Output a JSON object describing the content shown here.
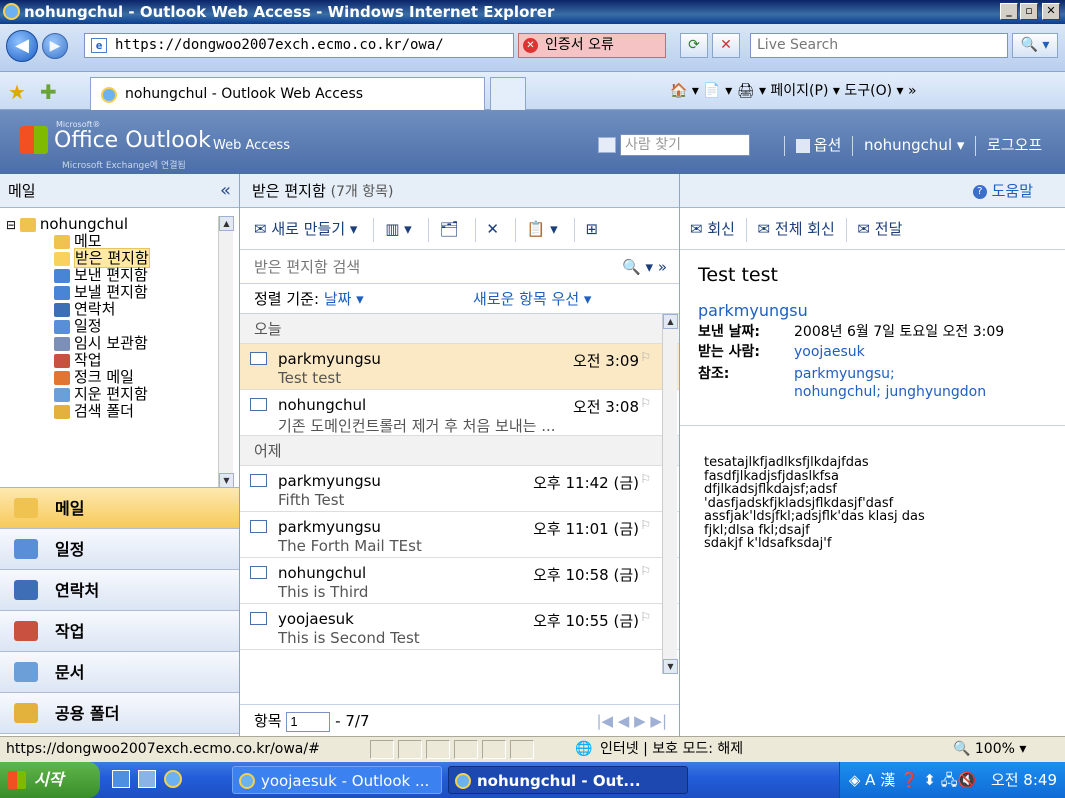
{
  "window": {
    "title": "nohungchul - Outlook Web Access - Windows Internet Explorer",
    "minimize": "_",
    "maximize": "▫",
    "close": "✕"
  },
  "browser": {
    "address": "https://dongwoo2007exch.ecmo.co.kr/owa/",
    "cert_error": "인증서 오류",
    "search_placeholder": "Live Search",
    "tab_title": "nohungchul - Outlook Web Access",
    "tools": "🏠 ▾  📄 ▾  🖨 ▾  페이지(P) ▾  도구(O) ▾  »"
  },
  "owa": {
    "logo_ms": "Microsoft®",
    "logo_title": "Office Outlook",
    "logo_title2": "Web Access",
    "logo_sub": "Microsoft Exchange에 연결됨",
    "find_people": "사람 찾기",
    "options": "옵션",
    "user": "nohungchul ▾",
    "logoff": "로그오프"
  },
  "left": {
    "header": "메일",
    "collapse": "«",
    "tree": [
      {
        "label": "nohungchul",
        "indent": 0
      },
      {
        "label": "메모",
        "indent": 1
      },
      {
        "label": "받은 편지함",
        "indent": 1,
        "selected": true
      },
      {
        "label": "보낸 편지함",
        "indent": 1
      },
      {
        "label": "보낼 편지함",
        "indent": 1
      },
      {
        "label": "연락처",
        "indent": 1
      },
      {
        "label": "일정",
        "indent": 1
      },
      {
        "label": "임시 보관함",
        "indent": 1
      },
      {
        "label": "작업",
        "indent": 1
      },
      {
        "label": "정크 메일",
        "indent": 1
      },
      {
        "label": "지운 편지함",
        "indent": 1
      },
      {
        "label": "검색 폴더",
        "indent": 1
      }
    ],
    "nav": [
      {
        "label": "메일",
        "active": true,
        "color": "#f0c350"
      },
      {
        "label": "일정",
        "active": false,
        "color": "#5b8ed8"
      },
      {
        "label": "연락처",
        "active": false,
        "color": "#3e6eb6"
      },
      {
        "label": "작업",
        "active": false,
        "color": "#c8513f"
      },
      {
        "label": "문서",
        "active": false,
        "color": "#6c9fd8"
      },
      {
        "label": "공용 폴더",
        "active": false,
        "color": "#e3b23c"
      }
    ]
  },
  "middle": {
    "header_title": "받은 편지함",
    "header_count": "(7개 항목)",
    "toolbar": {
      "new": "새로 만들기 ▾",
      "view": "▥ ▾",
      "move": "🗂",
      "delete": "✕",
      "copy": "📋 ▾",
      "more": "⊞"
    },
    "search_placeholder": "받은 편지함 검색",
    "search_btn": "🔍 ▾  »",
    "sort_label": "정렬 기준:",
    "sort_value": "날짜 ▾",
    "sort_order": "새로운 항목 우선 ▾",
    "groups": [
      {
        "name": "오늘",
        "messages": [
          {
            "from": "parkmyungsu",
            "time": "오전 3:09",
            "subject": "Test test",
            "selected": true
          },
          {
            "from": "nohungchul",
            "time": "오전 3:08",
            "subject": "기존 도메인컨트롤러 제거 후 처음 보내는 ...",
            "selected": false
          }
        ]
      },
      {
        "name": "어제",
        "messages": [
          {
            "from": "parkmyungsu",
            "time": "오후 11:42 (금)",
            "subject": "Fifth Test",
            "selected": false
          },
          {
            "from": "parkmyungsu",
            "time": "오후 11:01 (금)",
            "subject": "The Forth Mail TEst",
            "selected": false
          },
          {
            "from": "nohungchul",
            "time": "오후 10:58 (금)",
            "subject": "This is Third",
            "selected": false
          },
          {
            "from": "yoojaesuk",
            "time": "오후 10:55 (금)",
            "subject": "This is Second Test",
            "selected": false
          }
        ]
      }
    ],
    "pager_label": "항목",
    "pager_value": "1",
    "pager_total": "- 7/7",
    "pager_nav": "|◀ ◀ ▶ ▶|"
  },
  "reading": {
    "help": "도움말",
    "reply": "회신",
    "reply_all": "전체 회신",
    "forward": "전달",
    "subject": "Test test",
    "from": "parkmyungsu",
    "sent_label": "보낸 날짜:",
    "sent_value": "2008년 6월 7일 토요일 오전 3:09",
    "to_label": "받는 사람:",
    "to_value": "yoojaesuk",
    "cc_label": "참조:",
    "cc_value1": "parkmyungsu;",
    "cc_value2": "nohungchul; junghyungdon",
    "body": "tesatajlkfjadlksfjlkdajfdas\nfasdfjlkadjsfjdaslkfsa\ndfjlkadsjflkdajsf;adsf\n'dasfjadskfjkladsjflkdasjf'dasf\nassfjak'ldsjfkl;adsjflk'das klasj das\nfjkl;dlsa fkl;dsajf\nsdakjf k'ldsafksdaj'f"
  },
  "status": {
    "url": "https://dongwoo2007exch.ecmo.co.kr/owa/#",
    "zone": "인터넷 | 보호 모드: 해제",
    "zoom": "🔍 100%  ▾"
  },
  "taskbar": {
    "start": "시작",
    "tasks": [
      {
        "label": "yoojaesuk - Outlook ...",
        "active": false
      },
      {
        "label": "nohungchul - Out...",
        "active": true
      }
    ],
    "tray_time": "오전 8:49",
    "tray_icons": "◈ A 漢 ❓ ⬍  🖧🔇"
  }
}
